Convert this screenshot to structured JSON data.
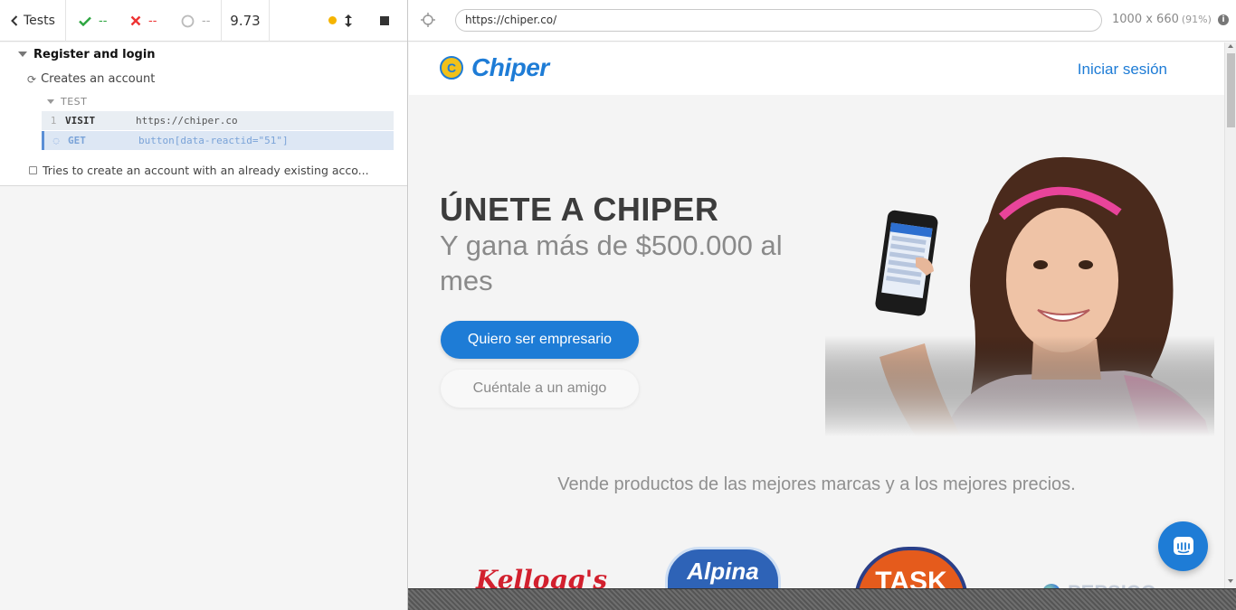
{
  "runner": {
    "tests_label": "Tests",
    "passed": "--",
    "failed": "--",
    "pending": "--",
    "duration": "9.73",
    "colors": {
      "pass": "#2ca53f",
      "fail": "#e33333",
      "running_dot": "#f5b400"
    }
  },
  "reporter": {
    "suite_title": "Register and login",
    "tests": [
      {
        "title": "Creates an account",
        "hook_label": "TEST",
        "commands": [
          {
            "num": "1",
            "name": "VISIT",
            "message": "https://chiper.co"
          },
          {
            "num": "",
            "name": "GET",
            "message": "button[data-reactid=\"51\"]"
          }
        ]
      },
      {
        "title": "Tries to create an account with an already existing acco..."
      }
    ]
  },
  "browser": {
    "url": "https://chiper.co/",
    "viewport": "1000 x 660",
    "scale": "(91%)"
  },
  "site": {
    "logo_coin": "C",
    "logo_text": "Chiper",
    "login_link": "Iniciar sesión",
    "hero_title": "ÚNETE A CHIPER",
    "hero_subtitle": "Y gana más de $500.000 al mes",
    "primary_cta": "Quiero ser empresario",
    "secondary_cta": "Cuéntale a un amigo",
    "tagline": "Vende productos de las mejores marcas y a los mejores precios.",
    "brands": [
      "Kellogg's",
      "Alpina",
      "TASK",
      "PEPSICO"
    ],
    "brand_color": "#1e7cd6"
  }
}
